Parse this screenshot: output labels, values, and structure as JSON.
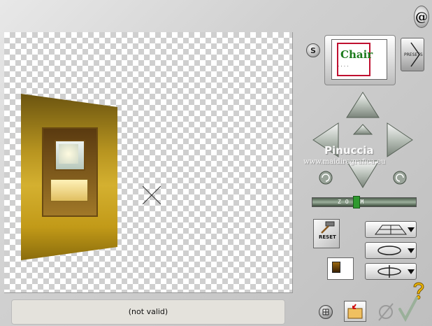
{
  "logo": {
    "glyph": "@"
  },
  "controls": {
    "s_label": "S",
    "presets_label": "PRESETS",
    "preview_word": "Chair",
    "reset_label": "RESET"
  },
  "watermark": {
    "name": "Pinuccia",
    "url": "www.maidiregrafica.eu"
  },
  "zoom": {
    "label": "ZOOM",
    "value": 0.42
  },
  "status": {
    "text": "(not valid)"
  },
  "colors": {
    "accent_green": "#2f9a2f",
    "preview_border": "#c01030"
  },
  "icons": [
    "logo-icon",
    "s-button-icon",
    "arrow-up-icon",
    "arrow-down-icon",
    "arrow-left-icon",
    "arrow-right-icon",
    "rotate-left-icon",
    "rotate-right-icon",
    "hammer-icon",
    "grid-icon",
    "folder-icon",
    "cancel-icon",
    "ok-checkmark-icon",
    "help-icon",
    "perspective-icon",
    "rotate-ellipse-icon",
    "flip-icon"
  ]
}
